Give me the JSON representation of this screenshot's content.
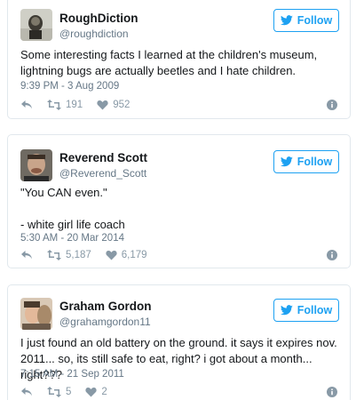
{
  "follow_label": "Follow",
  "colors": {
    "accent": "#1da1f2",
    "muted": "#657786",
    "border": "#e1e8ed"
  },
  "icons": {
    "follow": "twitter-bird-icon",
    "reply": "reply-icon",
    "retweet": "retweet-icon",
    "like": "heart-icon",
    "info": "info-icon"
  },
  "tweets": [
    {
      "display_name": "RoughDiction",
      "handle": "@roughdiction",
      "text": "Some interesting facts I learned at the children's museum, lightning bugs are actually beetles and I hate children.",
      "timestamp": "9:39 PM - 3 Aug 2009",
      "retweets": "191",
      "likes": "952"
    },
    {
      "display_name": "Reverend Scott",
      "handle": "@Reverend_Scott",
      "text": "\"You CAN even.\"\n\n- white girl life coach",
      "timestamp": "5:30 AM - 20 Mar 2014",
      "retweets": "5,187",
      "likes": "6,179"
    },
    {
      "display_name": "Graham Gordon",
      "handle": "@grahamgordon11",
      "text": "I just found an old battery on the ground. it says it expires nov. 2011... so, its still safe to eat, right? i got about a month... right???",
      "timestamp": "7:15 AM - 21 Sep 2011",
      "retweets": "5",
      "likes": "2"
    }
  ]
}
